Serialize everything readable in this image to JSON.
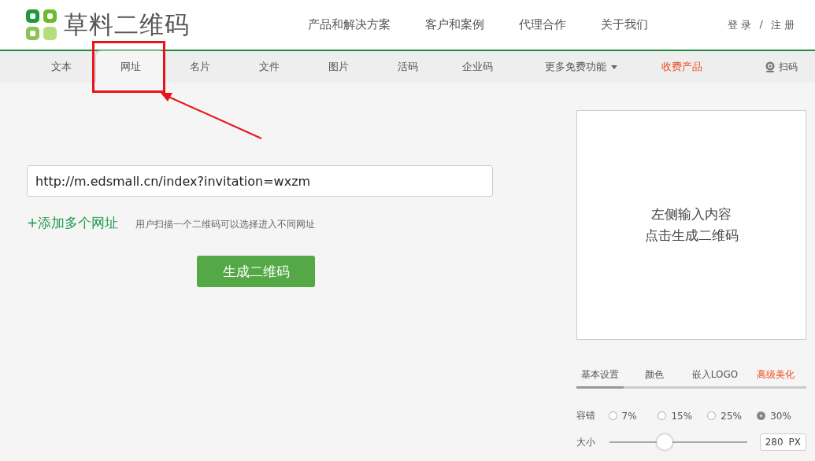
{
  "header": {
    "brand": "草料二维码",
    "menu": [
      "产品和解决方案",
      "客户和案例",
      "代理合作",
      "关于我们"
    ],
    "login": "登 录",
    "separator": "/",
    "register": "注 册"
  },
  "nav": {
    "items": [
      {
        "label": "文本",
        "selected": false,
        "kind": "plain"
      },
      {
        "label": "网址",
        "selected": true,
        "kind": "plain"
      },
      {
        "label": "名片",
        "selected": false,
        "kind": "plain"
      },
      {
        "label": "文件",
        "selected": false,
        "kind": "plain"
      },
      {
        "label": "图片",
        "selected": false,
        "kind": "plain"
      },
      {
        "label": "活码",
        "selected": false,
        "kind": "plain"
      },
      {
        "label": "企业码",
        "selected": false,
        "kind": "plain"
      },
      {
        "label": "更多免费功能",
        "selected": false,
        "kind": "dropdown"
      },
      {
        "label": "收费产品",
        "selected": false,
        "kind": "paid"
      }
    ],
    "scan": "扫码"
  },
  "url_input": {
    "value": "http://m.edsmall.cn/index?invitation=wxzm"
  },
  "add_link": "+添加多个网址",
  "hint": "用户扫描一个二维码可以选择进入不同网址",
  "generate_button": "生成二维码",
  "preview": {
    "lines": [
      "左侧输入内容",
      "点击生成二维码"
    ]
  },
  "settings": {
    "tabs": [
      {
        "label": "基本设置",
        "selected": true,
        "kind": "plain"
      },
      {
        "label": "颜色",
        "selected": false,
        "kind": "plain"
      },
      {
        "label": "嵌入LOGO",
        "selected": false,
        "kind": "plain"
      },
      {
        "label": "高级美化",
        "selected": false,
        "kind": "paid"
      }
    ],
    "error_correction": {
      "label": "容错",
      "options": [
        {
          "label": "7%",
          "selected": false
        },
        {
          "label": "15%",
          "selected": false
        },
        {
          "label": "25%",
          "selected": false
        },
        {
          "label": "30%",
          "selected": true
        }
      ]
    },
    "size": {
      "label": "大小",
      "level": 0.39,
      "value": "280",
      "unit": "PX"
    }
  }
}
